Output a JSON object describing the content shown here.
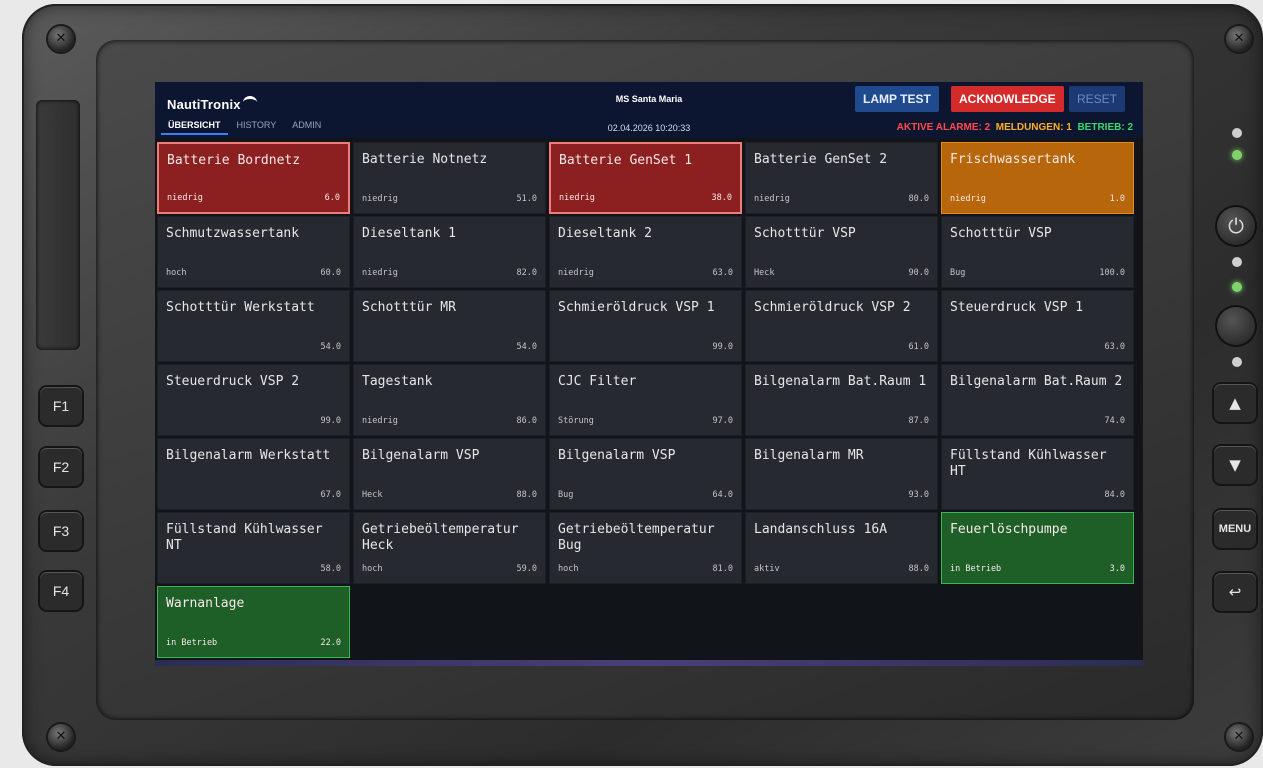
{
  "device": {
    "function_keys": [
      "F1",
      "F2",
      "F3",
      "F4"
    ],
    "right_buttons": {
      "up": "▲",
      "down": "▼",
      "menu": "MENU",
      "back": "↩",
      "power": "⏻"
    }
  },
  "header": {
    "logo": "NautiTronix",
    "tabs": [
      {
        "label": "ÜBERSICHT",
        "active": true
      },
      {
        "label": "HISTORY",
        "active": false
      },
      {
        "label": "ADMIN",
        "active": false
      }
    ],
    "ship_name": "MS Santa Maria",
    "datetime": "02.04.2026 10:20:33",
    "buttons": {
      "lamp_test": "LAMP TEST",
      "acknowledge": "ACKNOWLEDGE",
      "reset": "RESET"
    },
    "status": {
      "alarms": "AKTIVE ALARME: 2",
      "messages": "MELDUNGEN: 1",
      "operation": "BETRIEB: 2"
    },
    "colors": {
      "alarm": "#ff4b4b",
      "message": "#ffb020",
      "operation": "#3ad86a"
    }
  },
  "tiles": [
    {
      "name": "Batterie Bordnetz",
      "sub": "niedrig",
      "value": "6.0",
      "state": "red"
    },
    {
      "name": "Batterie Notnetz",
      "sub": "niedrig",
      "value": "51.0",
      "state": "normal"
    },
    {
      "name": "Batterie GenSet 1",
      "sub": "niedrig",
      "value": "38.0",
      "state": "red"
    },
    {
      "name": "Batterie GenSet 2",
      "sub": "niedrig",
      "value": "80.0",
      "state": "normal"
    },
    {
      "name": "Frischwassertank",
      "sub": "niedrig",
      "value": "1.0",
      "state": "orange"
    },
    {
      "name": "Schmutzwassertank",
      "sub": "hoch",
      "value": "60.0",
      "state": "normal"
    },
    {
      "name": "Dieseltank 1",
      "sub": "niedrig",
      "value": "82.0",
      "state": "normal"
    },
    {
      "name": "Dieseltank 2",
      "sub": "niedrig",
      "value": "63.0",
      "state": "normal"
    },
    {
      "name": "Schotttür VSP",
      "sub": "Heck",
      "value": "90.0",
      "state": "normal"
    },
    {
      "name": "Schotttür VSP",
      "sub": "Bug",
      "value": "100.0",
      "state": "normal"
    },
    {
      "name": "Schotttür Werkstatt",
      "sub": "",
      "value": "54.0",
      "state": "normal"
    },
    {
      "name": "Schotttür MR",
      "sub": "",
      "value": "54.0",
      "state": "normal"
    },
    {
      "name": "Schmieröldruck VSP 1",
      "sub": "",
      "value": "99.0",
      "state": "normal"
    },
    {
      "name": "Schmieröldruck VSP 2",
      "sub": "",
      "value": "61.0",
      "state": "normal"
    },
    {
      "name": "Steuerdruck VSP 1",
      "sub": "",
      "value": "63.0",
      "state": "normal"
    },
    {
      "name": "Steuerdruck VSP 2",
      "sub": "",
      "value": "99.0",
      "state": "normal"
    },
    {
      "name": "Tagestank",
      "sub": "niedrig",
      "value": "86.0",
      "state": "normal"
    },
    {
      "name": "CJC Filter",
      "sub": "Störung",
      "value": "97.0",
      "state": "normal"
    },
    {
      "name": "Bilgenalarm Bat.Raum 1",
      "sub": "",
      "value": "87.0",
      "state": "normal"
    },
    {
      "name": "Bilgenalarm Bat.Raum 2",
      "sub": "",
      "value": "74.0",
      "state": "normal"
    },
    {
      "name": "Bilgenalarm Werkstatt",
      "sub": "",
      "value": "67.0",
      "state": "normal"
    },
    {
      "name": "Bilgenalarm VSP",
      "sub": "Heck",
      "value": "88.0",
      "state": "normal"
    },
    {
      "name": "Bilgenalarm VSP",
      "sub": "Bug",
      "value": "64.0",
      "state": "normal"
    },
    {
      "name": "Bilgenalarm MR",
      "sub": "",
      "value": "93.0",
      "state": "normal"
    },
    {
      "name": "Füllstand Kühlwasser HT",
      "sub": "",
      "value": "84.0",
      "state": "normal"
    },
    {
      "name": "Füllstand Kühlwasser NT",
      "sub": "",
      "value": "58.0",
      "state": "normal"
    },
    {
      "name": "Getriebeöltemperatur Heck",
      "sub": "hoch",
      "value": "59.0",
      "state": "normal"
    },
    {
      "name": "Getriebeöltemperatur Bug",
      "sub": "hoch",
      "value": "81.0",
      "state": "normal"
    },
    {
      "name": "Landanschluss 16A",
      "sub": "aktiv",
      "value": "88.0",
      "state": "normal"
    },
    {
      "name": "Feuerlöschpumpe",
      "sub": "in Betrieb",
      "value": "3.0",
      "state": "green"
    },
    {
      "name": "Warnanlage",
      "sub": "in Betrieb",
      "value": "22.0",
      "state": "green"
    }
  ]
}
